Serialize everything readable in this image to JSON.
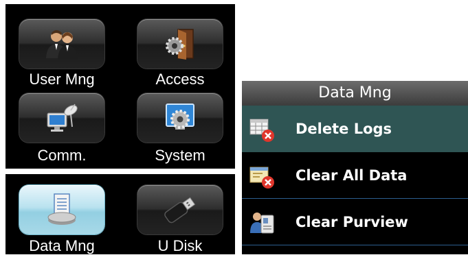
{
  "main_menu": {
    "items": [
      {
        "label": "User Mng",
        "icon": "users-icon"
      },
      {
        "label": "Access",
        "icon": "door-gear-icon"
      },
      {
        "label": "Comm.",
        "icon": "satellite-computer-icon"
      },
      {
        "label": "System",
        "icon": "system-gear-icon"
      },
      {
        "label": "Data Mng",
        "icon": "database-icon",
        "selected": true
      },
      {
        "label": "U Disk",
        "icon": "usb-drive-icon"
      }
    ]
  },
  "data_mng_screen": {
    "title": "Data Mng",
    "items": [
      {
        "label": "Delete Logs",
        "icon": "delete-logs-icon",
        "active": true
      },
      {
        "label": "Clear All Data",
        "icon": "clear-all-data-icon"
      },
      {
        "label": "Clear Purview",
        "icon": "clear-purview-icon"
      }
    ]
  },
  "colors": {
    "highlight_row": "#2f5554",
    "selected_tile": "#a8d9e8",
    "separator": "#2c5f8f"
  }
}
